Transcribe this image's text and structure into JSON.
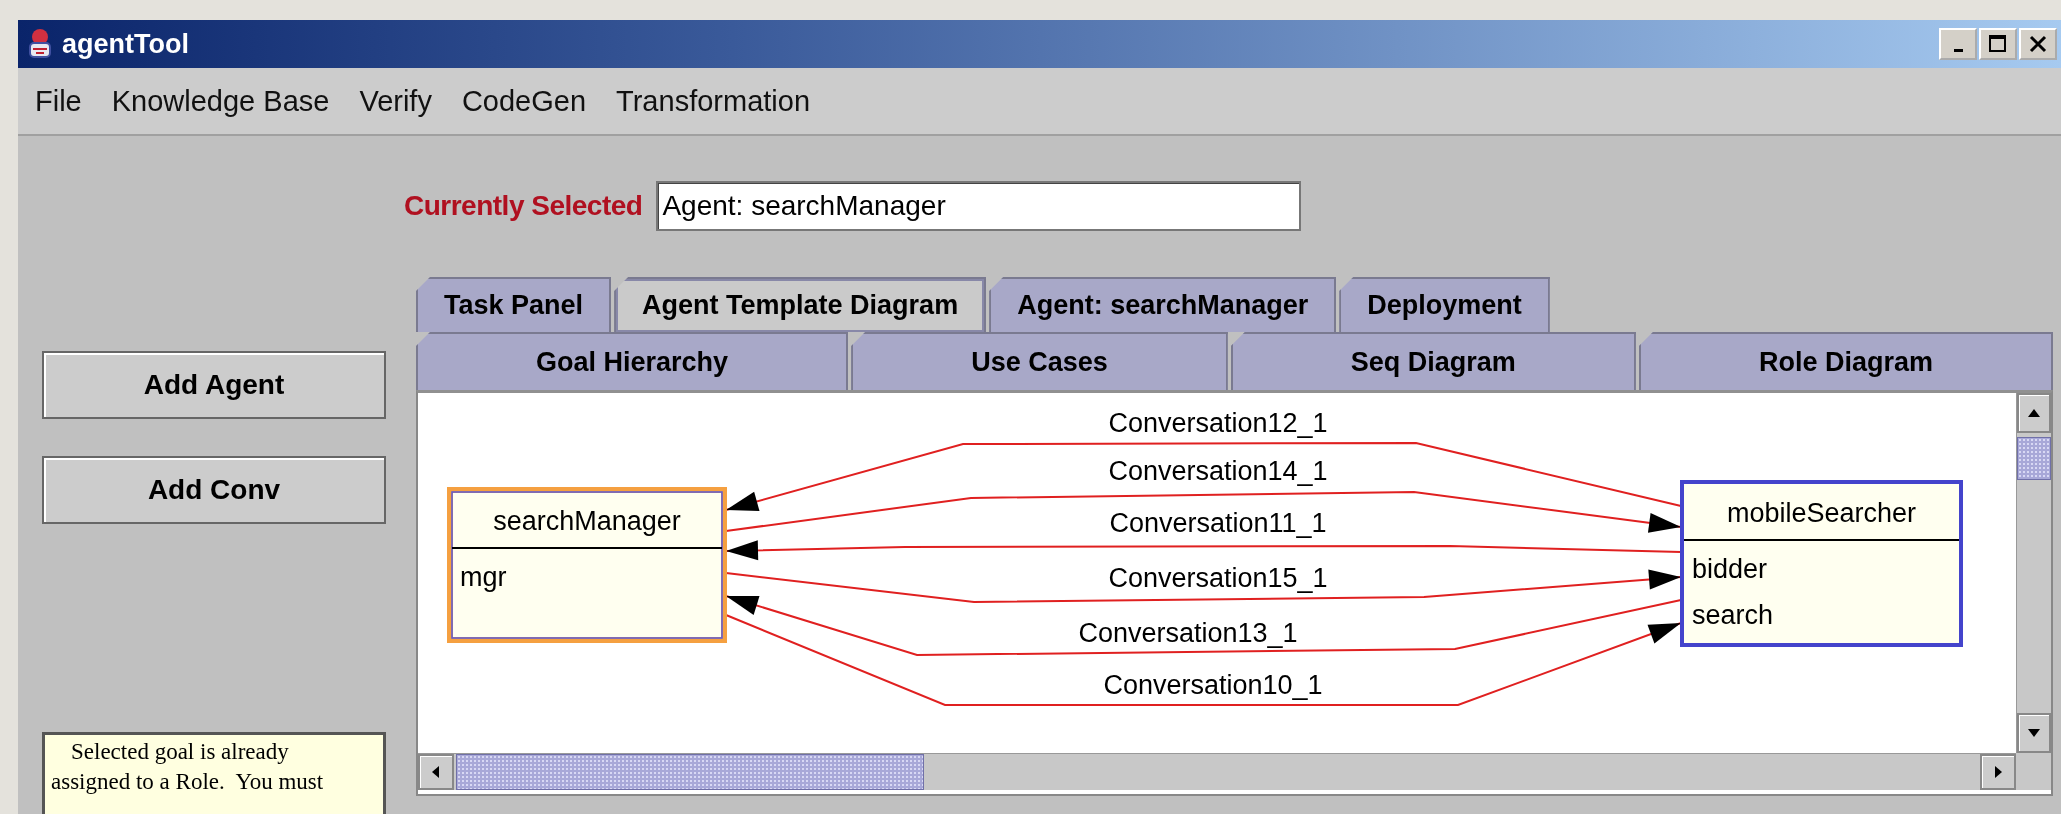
{
  "window": {
    "title": "agentTool"
  },
  "menu": [
    "File",
    "Knowledge Base",
    "Verify",
    "CodeGen",
    "Transformation"
  ],
  "sidebar": {
    "buttons": [
      "Add Agent",
      "Add Conv"
    ],
    "note": "Selected goal is already assigned to a Role.  You must"
  },
  "selection": {
    "label": "Currently Selected",
    "value": "Agent: searchManager"
  },
  "tab_rows": [
    [
      {
        "label": "Task Panel",
        "selected": false
      },
      {
        "label": "Agent Template Diagram",
        "selected": true
      },
      {
        "label": "Agent: searchManager",
        "selected": false
      },
      {
        "label": "Deployment",
        "selected": false
      }
    ],
    [
      {
        "label": "Goal Hierarchy",
        "selected": false
      },
      {
        "label": "Use Cases",
        "selected": false
      },
      {
        "label": "Seq Diagram",
        "selected": false
      },
      {
        "label": "Role Diagram",
        "selected": false
      }
    ]
  ],
  "diagram": {
    "nodes": [
      {
        "name": "searchManager",
        "selected": true,
        "roles": [
          "mgr"
        ]
      },
      {
        "name": "mobileSearcher",
        "selected": false,
        "roles": [
          "bidder",
          "search"
        ]
      }
    ],
    "edges": [
      {
        "label": "Conversation12_1",
        "kind": "leftward"
      },
      {
        "label": "Conversation14_1",
        "kind": "rightward"
      },
      {
        "label": "Conversation11_1",
        "kind": "leftward"
      },
      {
        "label": "Conversation15_1",
        "kind": "rightward"
      },
      {
        "label": "Conversation13_1",
        "kind": "leftward"
      },
      {
        "label": "Conversation10_1",
        "kind": "rightward"
      }
    ]
  }
}
